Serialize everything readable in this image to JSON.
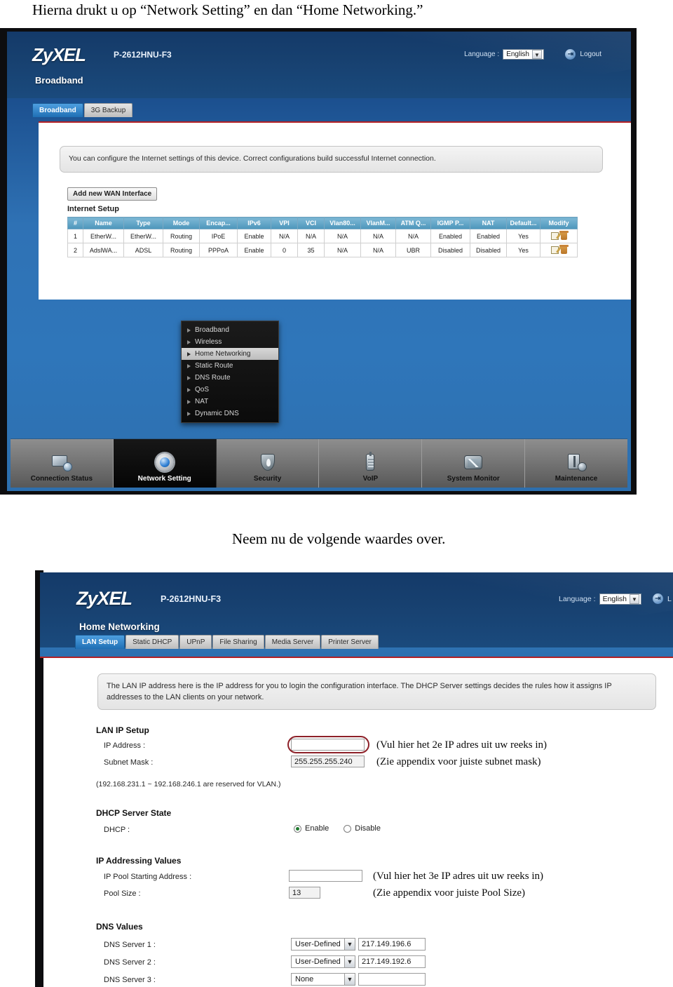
{
  "document": {
    "intro_text": "Hierna drukt u op “Network Setting” en dan “Home Networking.”",
    "mid_text": "Neem nu de volgende waardes over."
  },
  "shot1": {
    "brand": "ZyXEL",
    "model": "P-2612HNU-F3",
    "language_label": "Language :",
    "language_value": "English",
    "logout_label": "Logout",
    "logout_icon": "logout-icon",
    "page_title": "Broadband",
    "tabs": [
      {
        "label": "Broadband",
        "active": true
      },
      {
        "label": "3G Backup",
        "active": false
      }
    ],
    "note": "You can configure the Internet settings of this device. Correct configurations build successful Internet connection.",
    "add_button": "Add new WAN Interface",
    "section_title": "Internet Setup",
    "table": {
      "headers": [
        "#",
        "Name",
        "Type",
        "Mode",
        "Encap...",
        "IPv6",
        "VPI",
        "VCI",
        "Vlan80...",
        "VlanM...",
        "ATM Q...",
        "IGMP P...",
        "NAT",
        "Default...",
        "Modify"
      ],
      "rows": [
        [
          "1",
          "EtherW...",
          "EtherW...",
          "Routing",
          "IPoE",
          "Enable",
          "N/A",
          "N/A",
          "N/A",
          "N/A",
          "N/A",
          "Enabled",
          "Enabled",
          "Yes",
          ""
        ],
        [
          "2",
          "AdslWA...",
          "ADSL",
          "Routing",
          "PPPoA",
          "Enable",
          "0",
          "35",
          "N/A",
          "N/A",
          "UBR",
          "Disabled",
          "Disabled",
          "Yes",
          ""
        ]
      ],
      "modify_icons": [
        "edit-icon",
        "delete-icon"
      ]
    },
    "menu": [
      {
        "label": "Broadband",
        "selected": false
      },
      {
        "label": "Wireless",
        "selected": false
      },
      {
        "label": "Home Networking",
        "selected": true
      },
      {
        "label": "Static Route",
        "selected": false
      },
      {
        "label": "DNS Route",
        "selected": false
      },
      {
        "label": "QoS",
        "selected": false
      },
      {
        "label": "NAT",
        "selected": false
      },
      {
        "label": "Dynamic DNS",
        "selected": false
      }
    ],
    "nav": [
      {
        "label": "Connection Status",
        "icon": "monitor-icon",
        "active": false
      },
      {
        "label": "Network Setting",
        "icon": "gear-icon",
        "active": true
      },
      {
        "label": "Security",
        "icon": "shield-icon",
        "active": false
      },
      {
        "label": "VoIP",
        "icon": "phone-icon",
        "active": false
      },
      {
        "label": "System Monitor",
        "icon": "chart-icon",
        "active": false
      },
      {
        "label": "Maintenance",
        "icon": "tools-icon",
        "active": false
      }
    ]
  },
  "shot2": {
    "brand": "ZyXEL",
    "model": "P-2612HNU-F3",
    "language_label": "Language :",
    "language_value": "English",
    "logout_label": "L",
    "page_title": "Home Networking",
    "tabs": [
      {
        "label": "LAN Setup",
        "active": true
      },
      {
        "label": "Static DHCP",
        "active": false
      },
      {
        "label": "UPnP",
        "active": false
      },
      {
        "label": "File Sharing",
        "active": false
      },
      {
        "label": "Media Server",
        "active": false
      },
      {
        "label": "Printer Server",
        "active": false
      }
    ],
    "note": "The LAN IP address here is the IP address for you to login the configuration interface. The DHCP Server settings decides the rules how it assigns IP addresses to the LAN clients on your network.",
    "lan_ip_setup": {
      "heading": "LAN IP Setup",
      "ip_address_label": "IP Address :",
      "ip_address_value": "",
      "ip_address_annotation": "(Vul hier het 2e IP adres uit uw reeks in)",
      "subnet_mask_label": "Subnet Mask :",
      "subnet_mask_value": "255.255.255.240",
      "subnet_mask_annotation": "(Zie appendix voor juiste subnet mask)",
      "vlan_note": "(192.168.231.1 ~ 192.168.246.1 are reserved for VLAN.)"
    },
    "dhcp_server_state": {
      "heading": "DHCP Server State",
      "dhcp_label": "DHCP :",
      "options": [
        {
          "label": "Enable",
          "selected": true
        },
        {
          "label": "Disable",
          "selected": false
        }
      ]
    },
    "ip_addressing_values": {
      "heading": "IP Addressing Values",
      "pool_start_label": "IP Pool Starting Address :",
      "pool_start_value": "",
      "pool_start_annotation": "(Vul hier het 3e IP adres uit uw reeks in)",
      "pool_size_label": "Pool Size :",
      "pool_size_value": "13",
      "pool_size_annotation": "(Zie appendix voor juiste Pool Size)"
    },
    "dns_values": {
      "heading": "DNS Values",
      "rows": [
        {
          "label": "DNS Server 1 :",
          "mode": "User-Defined",
          "address": "217.149.196.6"
        },
        {
          "label": "DNS Server 2 :",
          "mode": "User-Defined",
          "address": "217.149.192.6"
        },
        {
          "label": "DNS Server 3 :",
          "mode": "None",
          "address": ""
        }
      ]
    }
  }
}
